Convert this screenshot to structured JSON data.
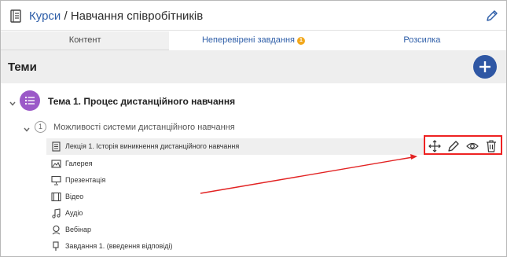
{
  "header": {
    "link_label": "Курси",
    "separator": " / ",
    "title": "Навчання співробітників"
  },
  "tabs": [
    {
      "label": "Контент",
      "active": true
    },
    {
      "label": "Неперевірені завдання",
      "badge": "1"
    },
    {
      "label": "Розсилка"
    }
  ],
  "themes": {
    "label": "Теми"
  },
  "theme": {
    "title": "Тема 1. Процес дистанційного навчання"
  },
  "module": {
    "number": "1",
    "title": "Можливості системи дистанційного навчання"
  },
  "items": [
    {
      "label": "Лекція 1. Історія виникнення дистанційного навчання",
      "icon": "document-icon"
    },
    {
      "label": "Галерея",
      "icon": "gallery-icon"
    },
    {
      "label": "Презентація",
      "icon": "presentation-icon"
    },
    {
      "label": "Відео",
      "icon": "video-icon"
    },
    {
      "label": "Аудіо",
      "icon": "audio-icon"
    },
    {
      "label": "Вебінар",
      "icon": "webinar-icon"
    },
    {
      "label": "Завдання 1. (введення відповіді)",
      "icon": "assignment-icon"
    }
  ],
  "colors": {
    "accent": "#2f57a4",
    "theme_icon": "#9b59c8",
    "badge": "#f2a81d",
    "annotation": "#e22222"
  }
}
